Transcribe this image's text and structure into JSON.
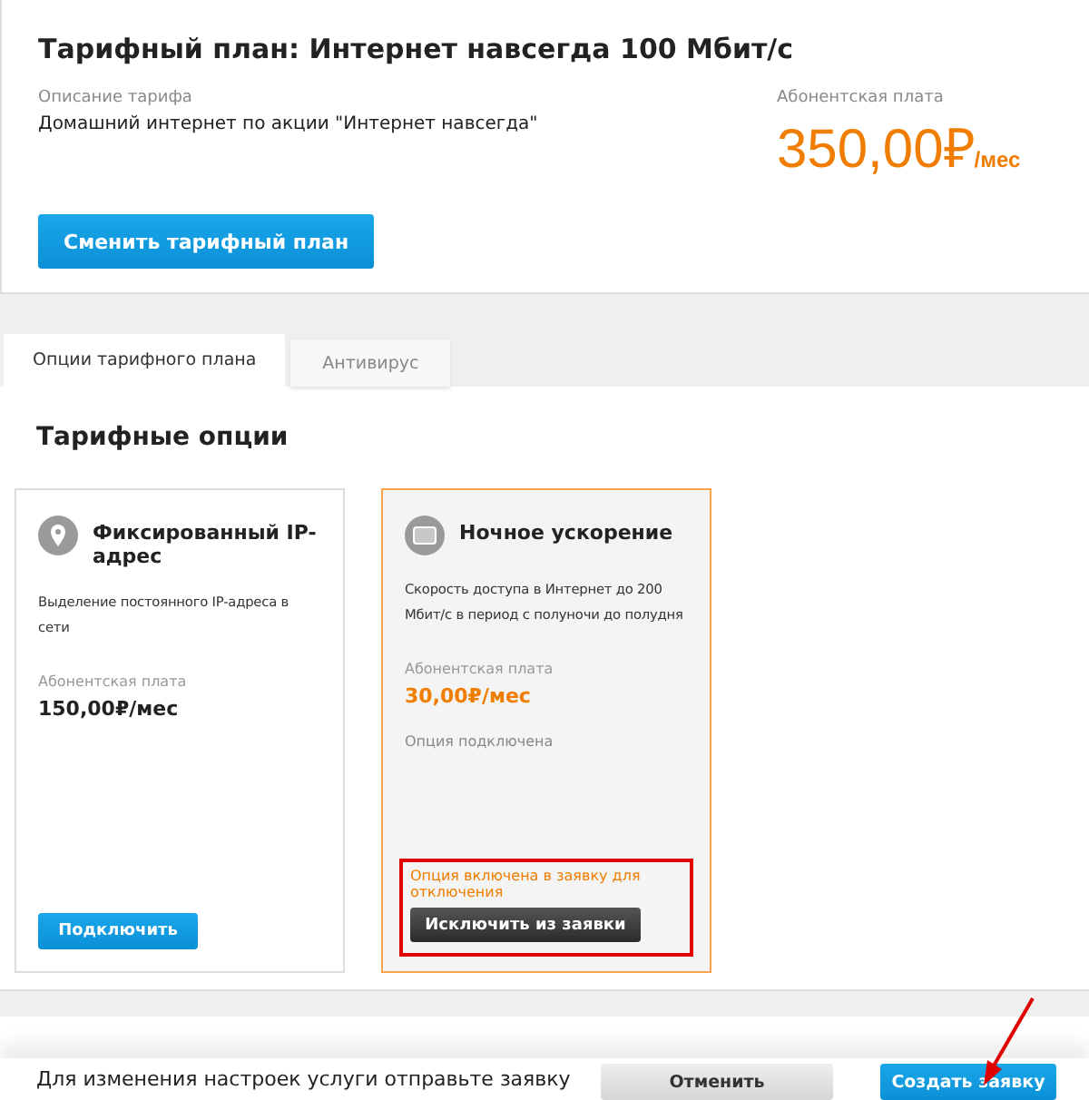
{
  "plan": {
    "title": "Тарифный план: Интернет навсегда 100 Мбит/с",
    "description_label": "Описание тарифа",
    "description": "Домашний интернет по акции \"Интернет навсегда\"",
    "fee_label": "Абонентская плата",
    "fee": "350,00₽",
    "fee_unit": "/мес",
    "change_button": "Сменить тарифный план"
  },
  "tabs": [
    {
      "label": "Опции тарифного плана",
      "selected": true
    },
    {
      "label": "Антивирус",
      "selected": false
    }
  ],
  "options": {
    "title": "Тарифные опции",
    "cards": [
      {
        "kind": "available",
        "title": "Фиксированный IP-адрес",
        "description": "Выделение постоянного IP-адреса в сети",
        "fee_label": "Абонентская плата",
        "fee": "150,00₽/мес",
        "button": "Подключить"
      },
      {
        "kind": "pending",
        "title": "Ночное ускорение",
        "description": "Скорость доступа в Интернет до 200 Мбит/с в период с полуночи до полудня",
        "fee_label": "Абонентская плата",
        "fee": "30,00₽/мес",
        "status": "Опция подключена",
        "note": "Опция включена в заявку для отключения",
        "button": "Исключить из заявки"
      }
    ]
  },
  "footer": {
    "message": "Для изменения настроек услуги отправьте заявку",
    "cancel_button": "Отменить",
    "submit_button": "Создать заявку"
  }
}
